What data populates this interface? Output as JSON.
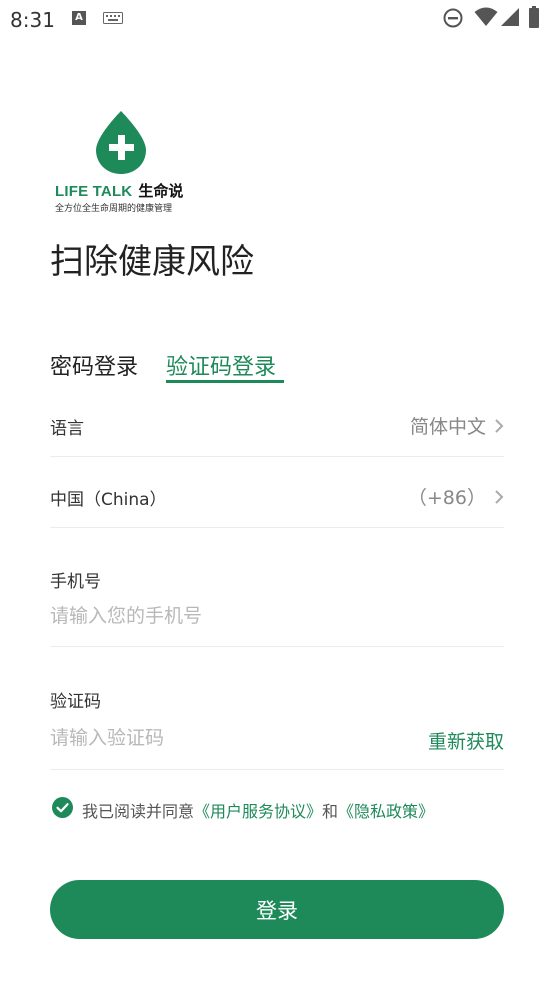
{
  "status_bar": {
    "time": "8:31",
    "a_icon_letter": "A"
  },
  "logo": {
    "brand_en": "LIFE TALK",
    "brand_cn": "生命说",
    "tagline": "全方位全生命周期的健康管理"
  },
  "title": "扫除健康风险",
  "tabs": [
    {
      "label": "密码登录",
      "active": false
    },
    {
      "label": "验证码登录",
      "active": true
    }
  ],
  "language_row": {
    "label": "语言",
    "value": "简体中文"
  },
  "region_row": {
    "label": "中国（China）",
    "value": "（+86）"
  },
  "phone_field": {
    "label": "手机号",
    "value": "",
    "placeholder": "请输入您的手机号"
  },
  "code_field": {
    "label": "验证码",
    "value": "",
    "placeholder": "请输入验证码",
    "resend_label": "重新获取"
  },
  "agreement": {
    "checked": true,
    "prefix": "我已阅读并同意",
    "terms_link": "《用户服务协议》",
    "joiner": "和",
    "privacy_link": "《隐私政策》"
  },
  "login_button": "登录",
  "colors": {
    "accent": "#1e8a5a",
    "placeholder": "#b8b8b8",
    "divider": "#ececec"
  }
}
